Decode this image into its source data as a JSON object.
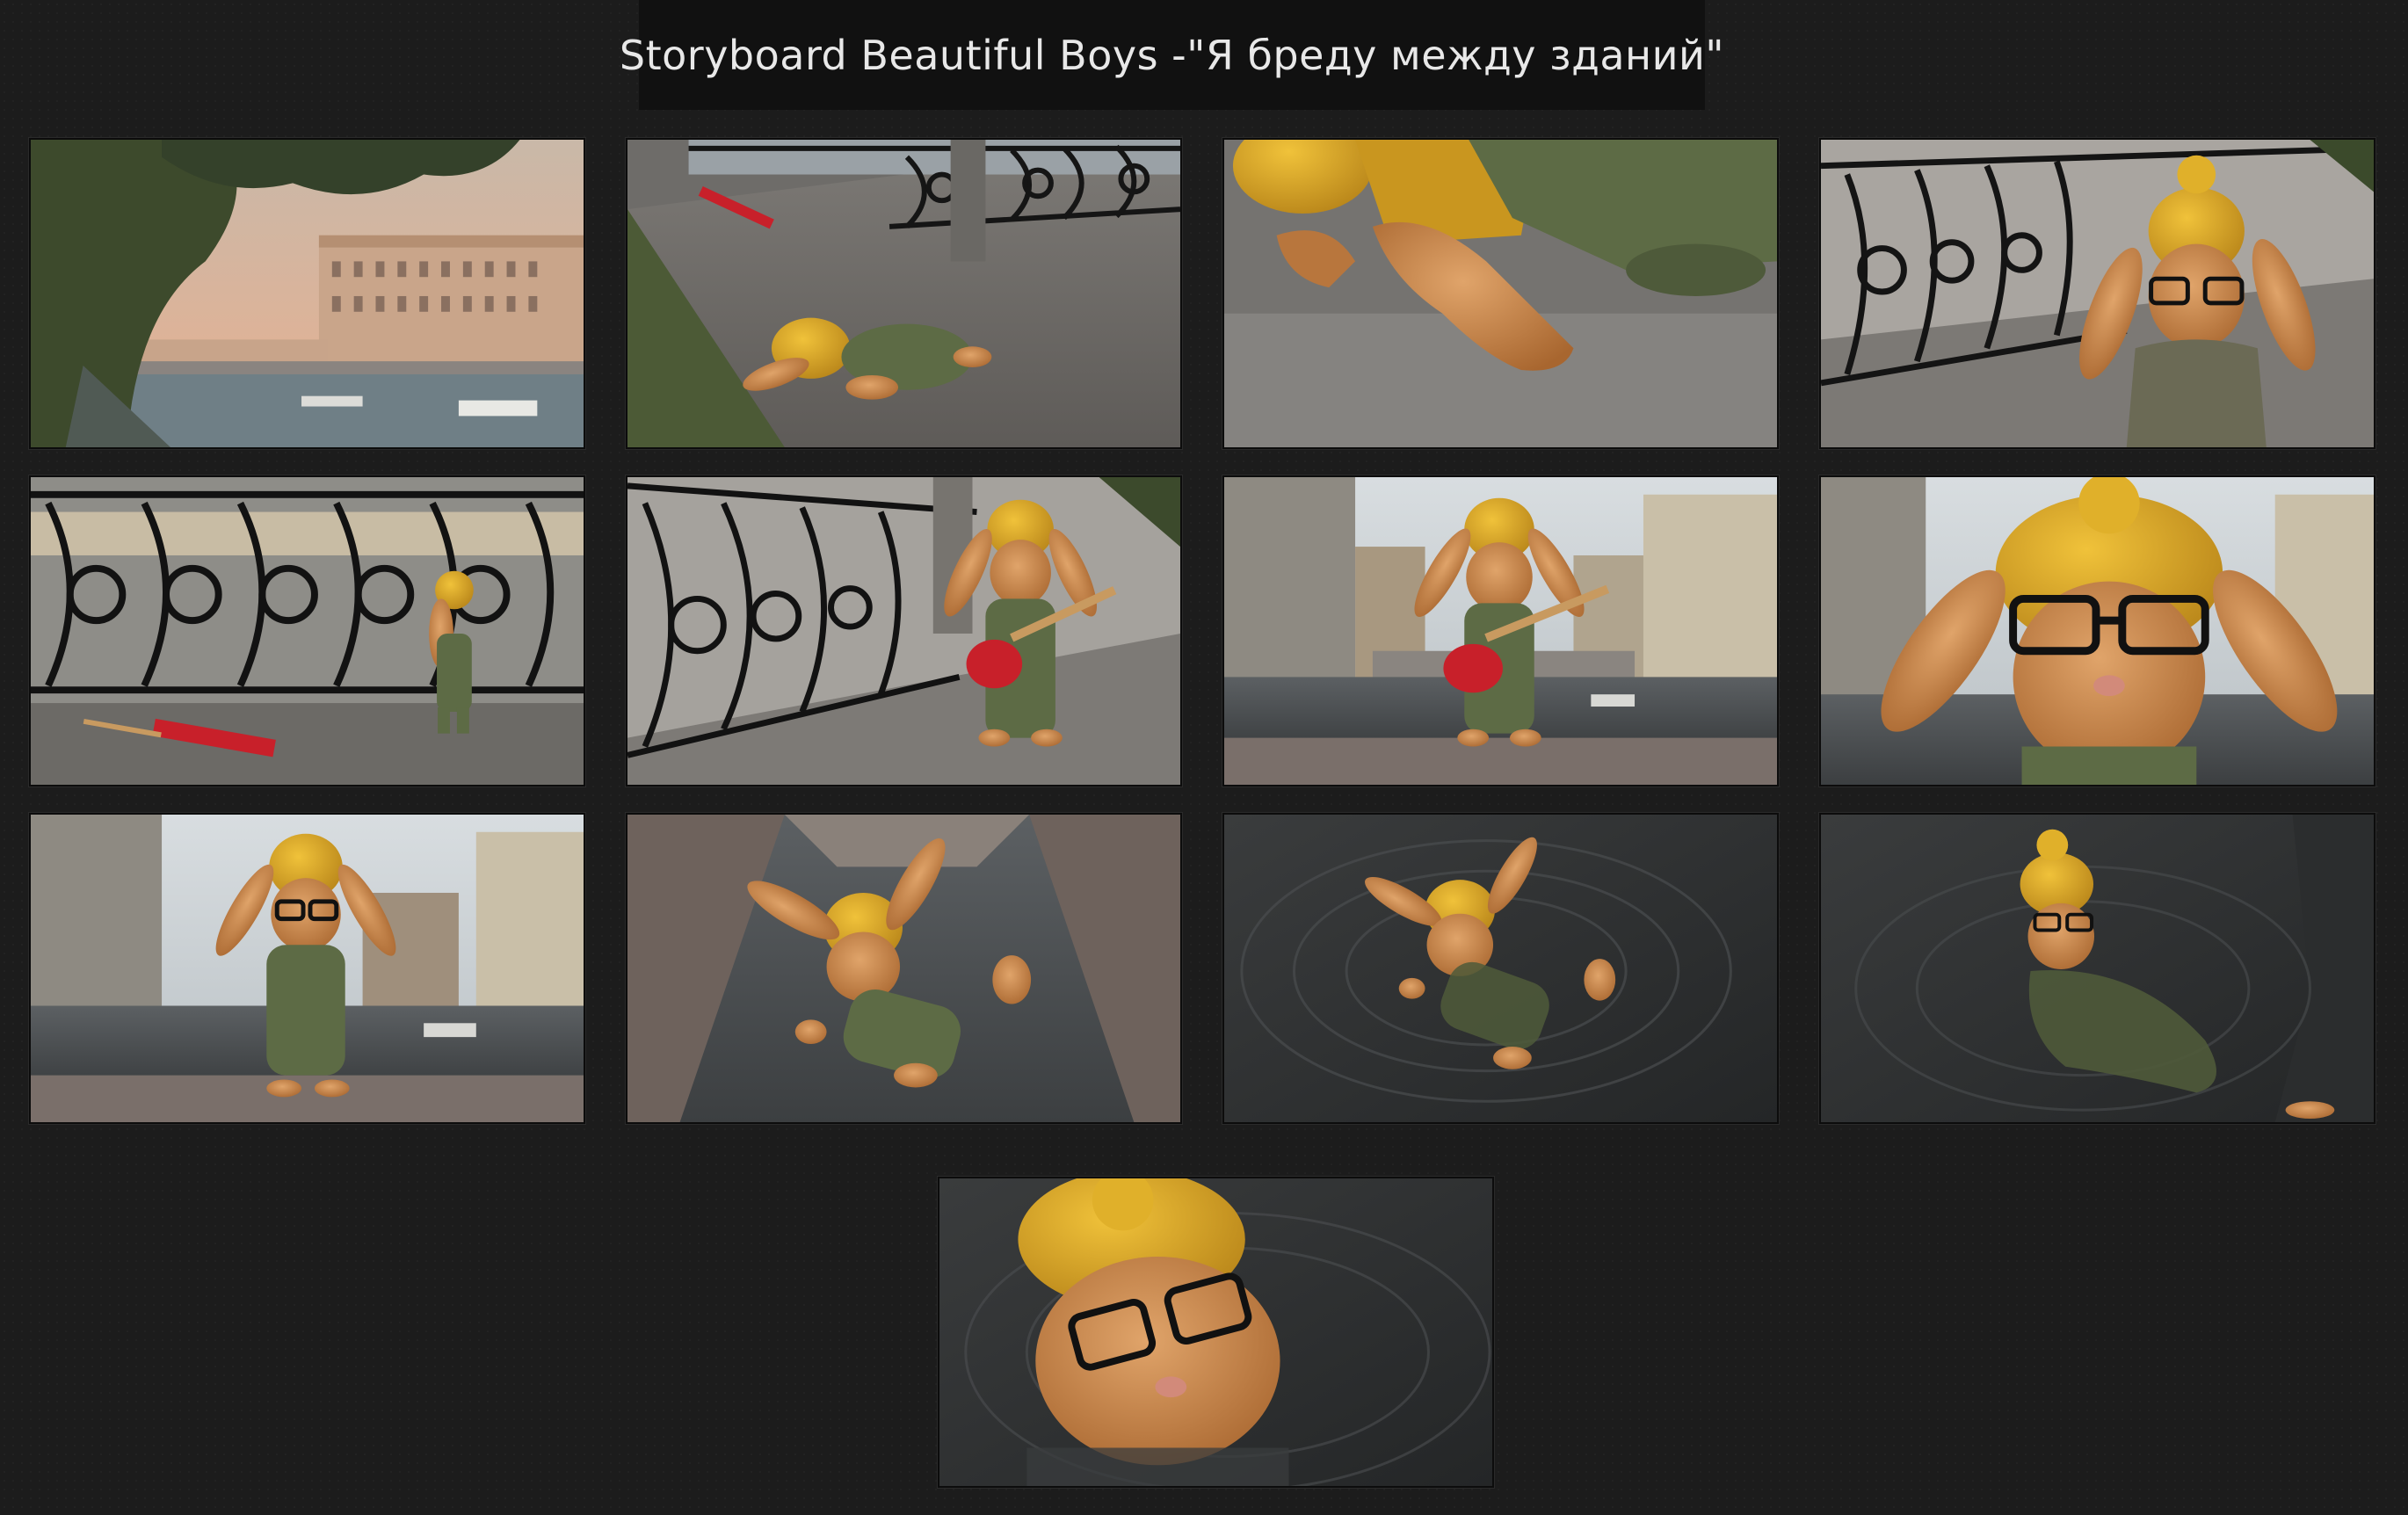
{
  "title": "Storyboard Beautiful Boys -\"Я бреду между зданий\"",
  "colors": {
    "background": "#1c1c1c",
    "title_bar": "#111111",
    "title_text": "#e8e8e8",
    "hat_yellow": "#d9a521",
    "fur": "#c9854a",
    "sweater_green": "#5d6b45",
    "guitar_red": "#c8202a",
    "water": "#4a4d4f",
    "railing": "#1a1a1a"
  },
  "frames": [
    {
      "icon": "canal-cityscape-image"
    },
    {
      "icon": "fallen-bunny-guitar-image"
    },
    {
      "icon": "bunny-paw-closeup-image"
    },
    {
      "icon": "bunny-holding-ears-image"
    },
    {
      "icon": "bunny-by-railing-image"
    },
    {
      "icon": "bunny-with-guitar-railing-image"
    },
    {
      "icon": "bunny-guitar-canal-image"
    },
    {
      "icon": "bunny-face-closeup-image"
    },
    {
      "icon": "bunny-standing-canal-image"
    },
    {
      "icon": "bunny-falling-image"
    },
    {
      "icon": "bunny-in-water-image"
    },
    {
      "icon": "bunny-floating-image"
    },
    {
      "icon": "bunny-sinking-closeup-image"
    }
  ]
}
